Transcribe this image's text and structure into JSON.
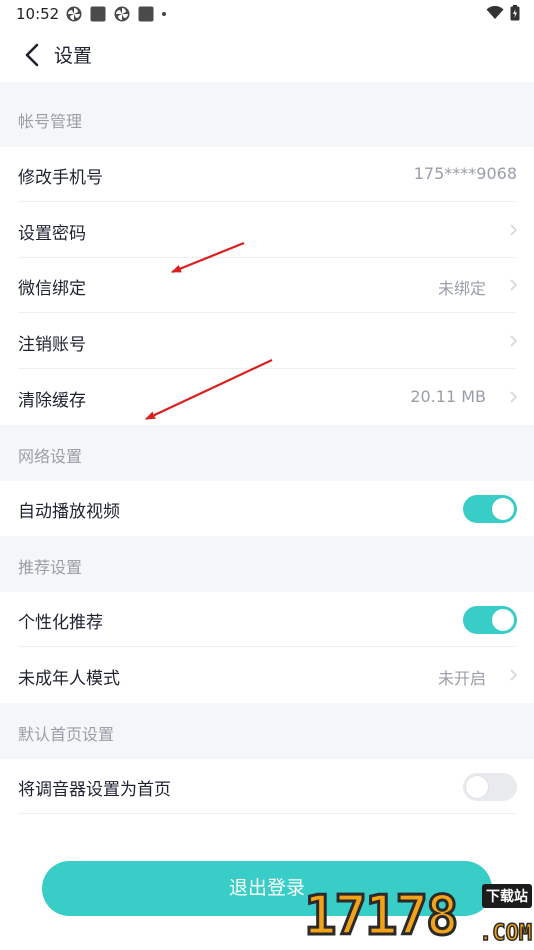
{
  "status_bar": {
    "time": "10:52"
  },
  "header": {
    "title": "设置"
  },
  "sections": {
    "account": {
      "title": "帐号管理",
      "change_phone": {
        "label": "修改手机号",
        "value": "175****9068"
      },
      "set_password": {
        "label": "设置密码"
      },
      "wechat_binding": {
        "label": "微信绑定",
        "value": "未绑定"
      },
      "cancel_account": {
        "label": "注销账号"
      },
      "clear_cache": {
        "label": "清除缓存",
        "value": "20.11 MB"
      }
    },
    "network": {
      "title": "网络设置",
      "autoplay_video": {
        "label": "自动播放视频",
        "enabled": true
      }
    },
    "recommend": {
      "title": "推荐设置",
      "personalized": {
        "label": "个性化推荐",
        "enabled": true
      },
      "minor_mode": {
        "label": "未成年人模式",
        "value": "未开启"
      }
    },
    "homepage": {
      "title": "默认首页设置",
      "tuner_homepage": {
        "label": "将调音器设置为首页",
        "enabled": false
      }
    }
  },
  "logout_label": "退出登录",
  "watermark": {
    "number": "17178",
    "tag": "下载站",
    "suffix": ".COM"
  },
  "colors": {
    "accent": "#38cdc6",
    "section_bg": "#f5f6f8",
    "annotation_arrow": "#d9201f"
  }
}
